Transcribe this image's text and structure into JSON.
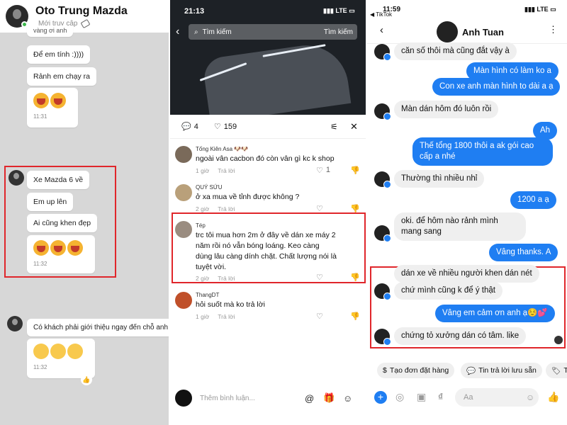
{
  "zalo": {
    "contact_name": "Oto Trung Mazda",
    "status": "Mới truy cập",
    "messages_top": [
      {
        "text": "vàng ơi anh"
      },
      {
        "text": "Để em tính :))))"
      },
      {
        "text": "Rảnh em chạy ra"
      }
    ],
    "time_1": "11:31",
    "group_2": [
      "Xe Mazda 6 về",
      "Em up lên",
      "Ai cũng khen đẹp"
    ],
    "time_2": "11:32",
    "group_3_text": "Có khách phải giới thiệu ngay đến chỗ anh",
    "time_3": "11:32"
  },
  "tiktok": {
    "time": "21:13",
    "network": "LTE",
    "search_placeholder": "Tìm kiếm",
    "search_button": "Tìm kiếm",
    "comment_count": "4",
    "like_count": "159",
    "comments": [
      {
        "name": "Tống Kiên Asa 🐶🐶",
        "text": "ngoài vân cacbon đó còn vân gì kc k shop",
        "time": "1 giờ",
        "reply": "Trả lời",
        "likes": "1"
      },
      {
        "name": "QUÝ SỨU",
        "text": "ở xa mua về tỉnh được không ?",
        "time": "2 giờ",
        "reply": "Trả lời",
        "likes": ""
      },
      {
        "name": "Tép",
        "text": "trc tôi mua hơn 2m ở đây về dán xe máy 2 năm rồi nó vẫn bóng loáng. Keo càng dùng lâu càng dính chặt. Chất lượng nói là tuyệt vời.",
        "time": "2 giờ",
        "reply": "Trả lời",
        "likes": ""
      },
      {
        "name": "ThangDT",
        "text": "hỏi suốt mà ko trả lời",
        "time": "1 giờ",
        "reply": "Trả lời",
        "likes": ""
      }
    ],
    "input_placeholder": "Thêm bình luận..."
  },
  "messenger": {
    "time": "11:59",
    "back_app": "◀ TikTok",
    "network": "LTE",
    "contact_name": "Anh Tuan",
    "messages": [
      {
        "dir": "in",
        "text": "căn số thôi mà cũng đắt vậy à"
      },
      {
        "dir": "out",
        "text": "Màn hình có làm ko a"
      },
      {
        "dir": "out",
        "text": "Con xe anh màn hình to dài a ạ"
      },
      {
        "dir": "in",
        "text": "Màn dán hôm đó luôn rồi"
      },
      {
        "dir": "out",
        "text": "Ah"
      },
      {
        "dir": "out",
        "text": "Thế tổng 1800 thôi a ak gói cao cấp a nhé"
      },
      {
        "dir": "in",
        "text": "Thường thì nhiều nhỉ"
      },
      {
        "dir": "out",
        "text": "1200 a ạ"
      },
      {
        "dir": "in",
        "text": "oki. để hôm nào rảnh mình mang sang"
      },
      {
        "dir": "out",
        "text": "Vâng thanks. A"
      },
      {
        "dir": "in",
        "text": "dán xe về nhiều người khen dán nét"
      },
      {
        "dir": "in",
        "text": "chứ mình cũng k để ý thật"
      },
      {
        "dir": "out",
        "text": "Vâng em cảm ơn anh ạ☺️💕"
      },
      {
        "dir": "in",
        "text": "chứng tỏ xưởng dán có tâm. like"
      }
    ],
    "chips": [
      "Tạo đơn đặt hàng",
      "Tin trả lời lưu sẵn",
      "T"
    ],
    "input_placeholder": "Aa"
  },
  "colors": {
    "highlight": "#e0262b",
    "messenger_blue": "#1f7ef2",
    "zalo_bg": "#d7d7d7"
  }
}
